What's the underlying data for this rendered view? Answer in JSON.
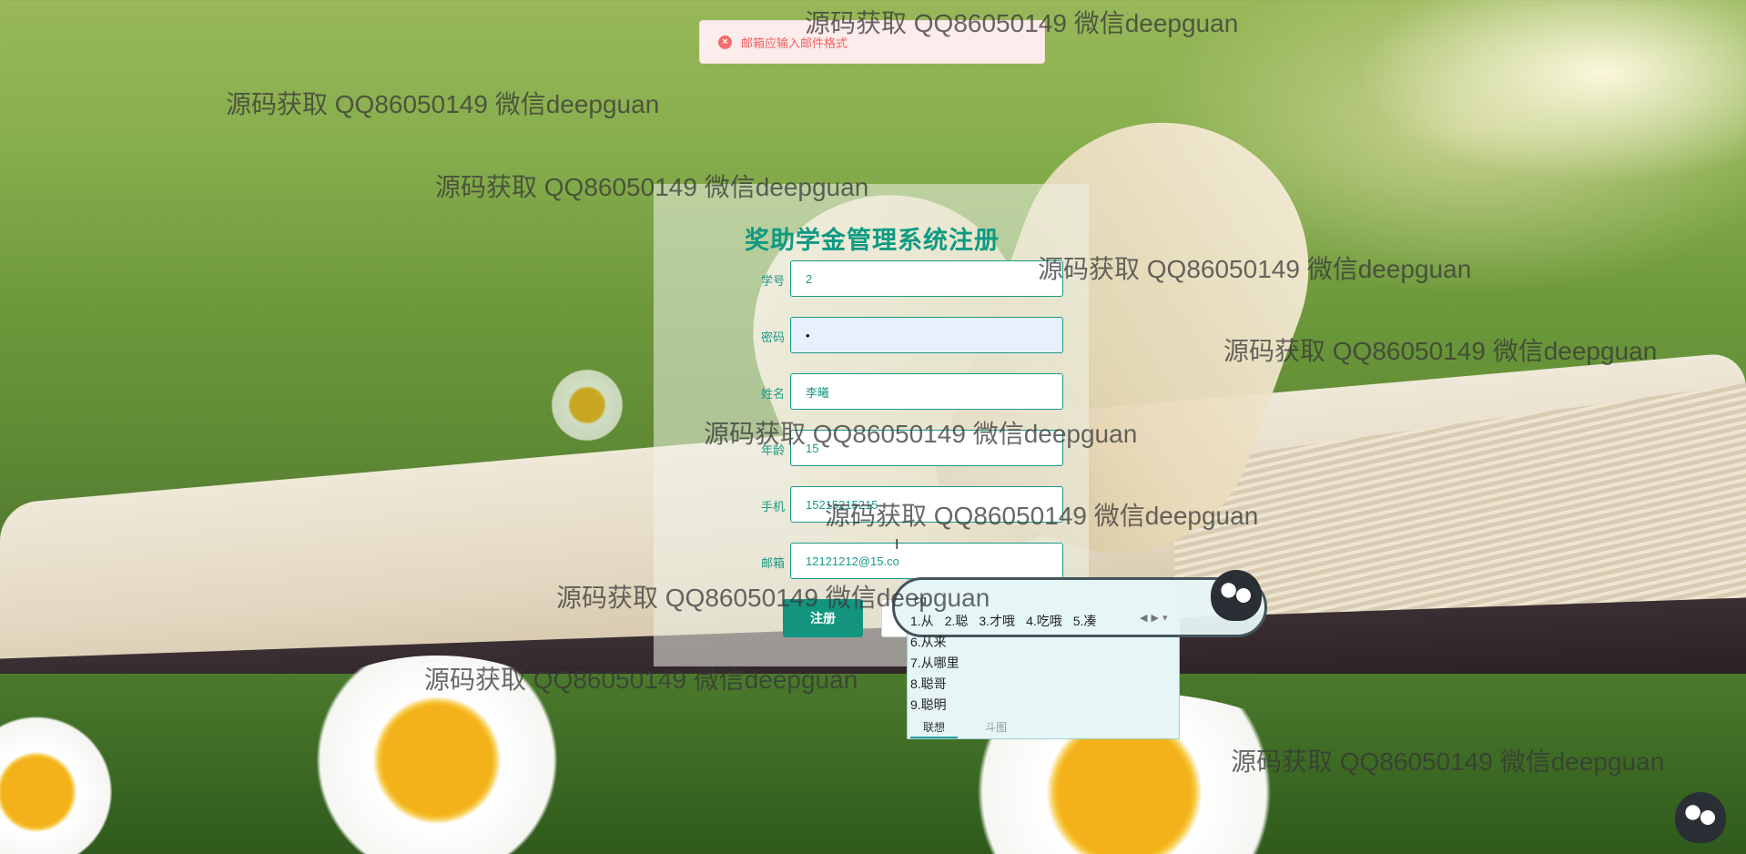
{
  "toast": {
    "message": "邮箱应输入邮件格式",
    "icon": "error-circle-icon",
    "color": "#f56c6c"
  },
  "form": {
    "title": "奖助学金管理系统注册",
    "fields": [
      {
        "label": "学号",
        "value": "2"
      },
      {
        "label": "密码",
        "value": "•"
      },
      {
        "label": "姓名",
        "value": "李曦"
      },
      {
        "label": "年龄",
        "value": "15"
      },
      {
        "label": "手机",
        "value": "15215215215"
      },
      {
        "label": "邮箱",
        "value": "12121212@15.co"
      }
    ],
    "register_button": "注册",
    "accent": "#13947f"
  },
  "ime": {
    "pinyin": "cg",
    "candidates": [
      "1.从",
      "2.聪",
      "3.才哦",
      "4.吃哦",
      "5.凑"
    ],
    "more": [
      "6.从来",
      "7.从哪里",
      "8.聪哥",
      "9.聪明"
    ],
    "tabs": [
      "联想",
      "斗图"
    ]
  },
  "watermark": "源码获取 QQ86050149 微信deepguan"
}
